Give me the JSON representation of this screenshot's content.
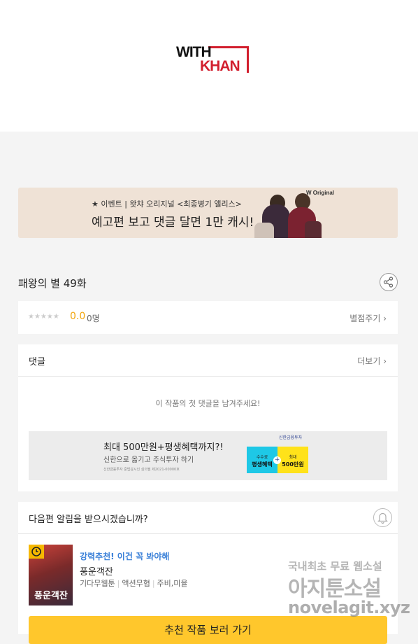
{
  "logo": {
    "top": "WITH",
    "bottom": "KHAN"
  },
  "banner": {
    "subtitle": "★ 이벤트 | 왓챠 오리지널 <최종병기 앨리스>",
    "main": "예고편 보고 댓글 달면 1만 캐시!",
    "brand": "W Original"
  },
  "episode": {
    "title": "패왕의 별 49화"
  },
  "rating": {
    "stars": "★★★★★",
    "score": "0.0",
    "count": "0명",
    "action": "별점주기 ›"
  },
  "comments": {
    "title": "댓글",
    "more": "더보기 ›",
    "empty": "이 작품의 첫 댓글을 남겨주세요!",
    "ad": {
      "main": "최대 500만원+평생혜택까지?!",
      "sub": "신한으로 옮기고 주식투자 하기",
      "fine": "신한금융투자 준법감시인 심의필 제2021-00000호",
      "logo": "신한금융투자",
      "box1_top": "수수료",
      "box1_bottom": "평생혜택",
      "box2_top": "최대",
      "box2_bottom": "500만원",
      "plus": "+"
    }
  },
  "notify": {
    "title": "다음편 알림을 받으시겠습니까?",
    "recommend": "강력추천! 이건 꼭 봐야해",
    "novel_title": "풍운객잔",
    "thumb_text": "풍운객잔",
    "meta": [
      "기다무웹툰",
      "액션무협",
      "주비,미율"
    ],
    "button": "추천 작품 보러 가기"
  },
  "watermark": {
    "line1": "국내최초 무료 웹소설",
    "line2": "아지툰소설",
    "line3": "novelagit.xyz"
  }
}
